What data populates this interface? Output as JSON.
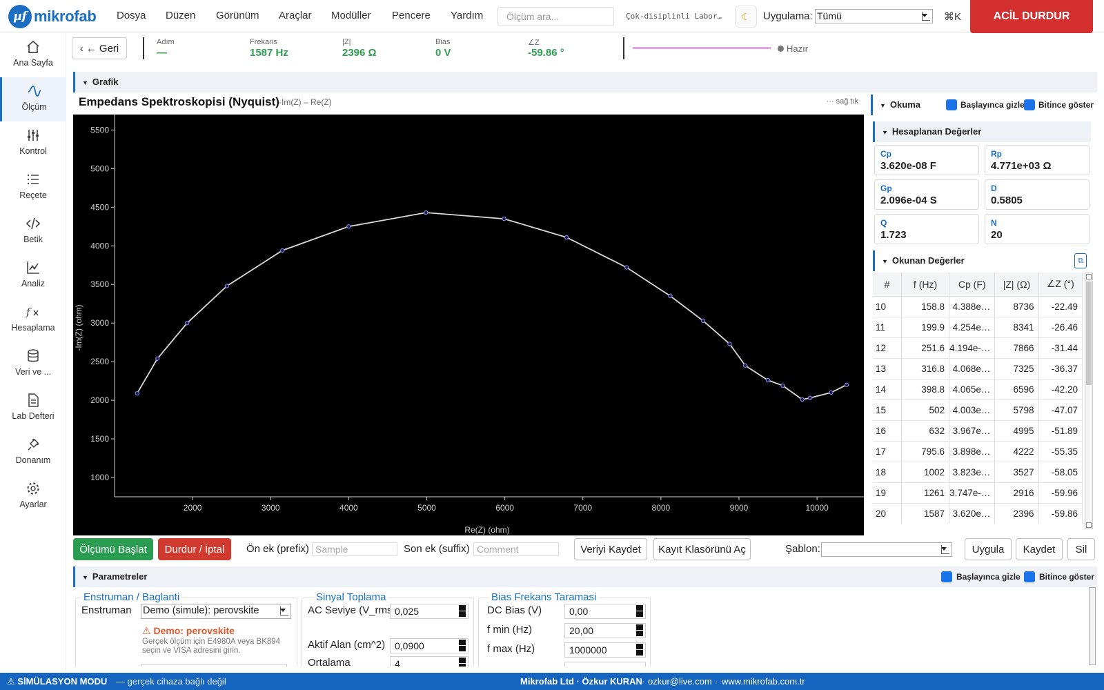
{
  "app": {
    "logo_symbol": "µf",
    "logo_text": "mikrofab"
  },
  "menu": [
    "Dosya",
    "Düzen",
    "Görünüm",
    "Araçlar",
    "Modüller",
    "Pencere",
    "Yardım"
  ],
  "search": {
    "placeholder": "Ölçüm ara..."
  },
  "lab_name": "Çok-disiplinli Labor…",
  "app_filter": {
    "label": "Uygulama:",
    "value": "Tümü"
  },
  "shortcut": "⌘K",
  "emergency_stop": "ACİL DURDUR",
  "sidebar": [
    {
      "label": "Ana Sayfa",
      "icon": "home-icon"
    },
    {
      "label": "Ölçüm",
      "icon": "wave-icon",
      "active": true
    },
    {
      "label": "Kontrol",
      "icon": "sliders-icon"
    },
    {
      "label": "Reçete",
      "icon": "list-icon"
    },
    {
      "label": "Betik",
      "icon": "code-icon"
    },
    {
      "label": "Analiz",
      "icon": "chart-icon"
    },
    {
      "label": "Hesaplama",
      "icon": "function-icon"
    },
    {
      "label": "Veri ve ...",
      "icon": "database-icon"
    },
    {
      "label": "Lab Defteri",
      "icon": "notebook-icon"
    },
    {
      "label": "Donanım",
      "icon": "plug-icon"
    },
    {
      "label": "Ayarlar",
      "icon": "gear-icon"
    }
  ],
  "status": {
    "back_label": "← Geri",
    "step": {
      "k": "Adım",
      "v": "—"
    },
    "freq": {
      "k": "Frekans",
      "v": "1587 Hz"
    },
    "z": {
      "k": "|Z|",
      "v": "2396 Ω"
    },
    "bias": {
      "k": "Bias",
      "v": "0 V"
    },
    "phase": {
      "k": "∠Z",
      "v": "-59.86 °"
    },
    "state": "Hazır"
  },
  "graph_section": "Grafik",
  "chart_header": {
    "title": "Empedans Spektroskopisi (Nyquist)",
    "subtitle": "-Im(Z) – Re(Z)",
    "hint": "··· sağ tık"
  },
  "chart_data": {
    "type": "line",
    "xlabel": "Re(Z) (ohm)",
    "ylabel": "-Im(Z) (ohm)",
    "xlim": [
      1000,
      10600
    ],
    "ylim": [
      750,
      5700
    ],
    "xticks": [
      2000,
      3000,
      4000,
      5000,
      6000,
      7000,
      8000,
      9000,
      10000
    ],
    "yticks": [
      1000,
      1500,
      2000,
      2500,
      3000,
      3500,
      4000,
      4500,
      5000,
      5500
    ],
    "series": [
      {
        "x": [
          1290,
          1550,
          1930,
          2440,
          3150,
          4000,
          4990,
          5990,
          6790,
          7560,
          8120,
          8540,
          8880,
          9080,
          9370,
          9560,
          9810,
          9910,
          10180,
          10380
        ],
        "y": [
          2090,
          2540,
          3000,
          3480,
          3940,
          4250,
          4430,
          4350,
          4110,
          3720,
          3350,
          3030,
          2730,
          2450,
          2260,
          2190,
          2010,
          2030,
          2100,
          2200
        ]
      }
    ]
  },
  "readout": {
    "section": "Okuma",
    "hide_on_start": "Başlayınca gizle",
    "show_on_end": "Bitince göster",
    "calc_title": "Hesaplanan Değerler",
    "cards": [
      {
        "k": "Cp",
        "v": "3.620e-08 F"
      },
      {
        "k": "Rp",
        "v": "4.771e+03 Ω"
      },
      {
        "k": "Gp",
        "v": "2.096e-04 S"
      },
      {
        "k": "D",
        "v": "0.5805"
      },
      {
        "k": "Q",
        "v": "1.723"
      },
      {
        "k": "N",
        "v": "20"
      }
    ],
    "read_title": "Okunan Değerler",
    "columns": [
      "#",
      "f (Hz)",
      "Cp (F)",
      "|Z| (Ω)",
      "∠Z (°)"
    ],
    "rows": [
      [
        "10",
        "158.8",
        "4.388e…",
        "8736",
        "-22.49"
      ],
      [
        "11",
        "199.9",
        "4.254e…",
        "8341",
        "-26.46"
      ],
      [
        "12",
        "251.6",
        "4.194e-…",
        "7866",
        "-31.44"
      ],
      [
        "13",
        "316.8",
        "4.068e…",
        "7325",
        "-36.37"
      ],
      [
        "14",
        "398.8",
        "4.065e…",
        "6596",
        "-42.20"
      ],
      [
        "15",
        "502",
        "4.003e…",
        "5798",
        "-47.07"
      ],
      [
        "16",
        "632",
        "3.967e…",
        "4995",
        "-51.89"
      ],
      [
        "17",
        "795.6",
        "3.898e…",
        "4222",
        "-55.35"
      ],
      [
        "18",
        "1002",
        "3.823e…",
        "3527",
        "-58.05"
      ],
      [
        "19",
        "1261",
        "3.747e-…",
        "2916",
        "-59.96"
      ],
      [
        "20",
        "1587",
        "3.620e…",
        "2396",
        "-59.86"
      ]
    ]
  },
  "toolbar": {
    "start": "Ölçümü Başlat",
    "stop": "Durdur / İptal",
    "prefix_label": "Ön ek (prefix)",
    "prefix_placeholder": "Sample",
    "suffix_label": "Son ek (suffix)",
    "suffix_placeholder": "Comment",
    "save_data": "Veriyi Kaydet",
    "open_folder": "Kayıt Klasörünü Aç",
    "template_label": "Şablon:",
    "template_value": "",
    "apply": "Uygula",
    "save": "Kaydet",
    "delete": "Sil"
  },
  "params": {
    "section": "Parametreler",
    "hide_on_start": "Başlayınca gizle",
    "show_on_end": "Bitince göster",
    "instrument": {
      "title": "Enstruman / Baglanti",
      "label": "Enstruman",
      "value": "Demo (simule): perovskite",
      "warn_title": "Demo: perovskite",
      "warn_text": "Gerçek ölçüm için E4980A veya BK894 seçin ve VISA adresini girin."
    },
    "signal": {
      "title": "Sinyal Toplama",
      "fields": [
        {
          "label": "AC Seviye (V_rms)",
          "value": "0,025"
        },
        {
          "label": "Aktif Alan (cm^2)",
          "value": "0,0900"
        },
        {
          "label": "Ortalama",
          "value": "4"
        }
      ]
    },
    "bias": {
      "title": "Bias Frekans Taramasi",
      "fields": [
        {
          "label": "DC Bias (V)",
          "value": "0,00"
        },
        {
          "label": "f min (Hz)",
          "value": "20,00"
        },
        {
          "label": "f max (Hz)",
          "value": "1000000"
        }
      ]
    }
  },
  "footer": {
    "mode": "SİMÜLASYON MODU",
    "mode_note": "— gerçek cihaza bağlı değil",
    "company": "Mikrofab Ltd · Özkur KURAN",
    "email": "ozkur@live.com",
    "site": "www.mikrofab.com.tr",
    "sep": "·"
  },
  "colors": {
    "accent": "#1a6fc2",
    "stop": "#d32f2f",
    "start": "#2a9d52",
    "value_green": "#2e9e4f",
    "footer": "#1565c0",
    "line": "#d8d8d8",
    "marker": "#7f7fe0"
  }
}
